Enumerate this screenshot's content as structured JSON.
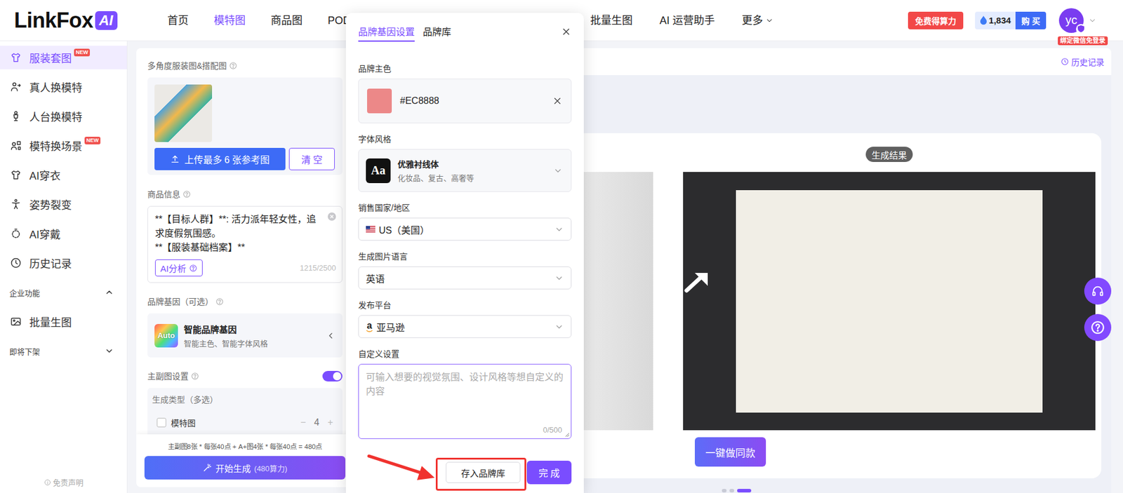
{
  "header": {
    "logo": {
      "text": "LinkFox",
      "badge": "AI"
    },
    "nav": [
      {
        "label": "首页",
        "selected": false,
        "dropdown": false
      },
      {
        "label": "模特图",
        "selected": true,
        "dropdown": false
      },
      {
        "label": "商品图",
        "selected": false,
        "dropdown": false
      },
      {
        "label": "POD",
        "selected": false,
        "dropdown": false
      },
      {
        "label": "批量生图",
        "selected": false,
        "dropdown": false
      },
      {
        "label": "AI 运营助手",
        "selected": false,
        "dropdown": false
      },
      {
        "label": "更多",
        "selected": false,
        "dropdown": true
      }
    ],
    "free_button": "免费得算力",
    "points": "1,834",
    "buy_button": "购 买",
    "avatar": "yc",
    "bind_tag": "绑定微信免登录"
  },
  "sidebar": {
    "items": [
      {
        "kind": "item",
        "label": "服装套图",
        "badge": "NEW",
        "selected": true
      },
      {
        "kind": "item",
        "label": "真人换模特",
        "selected": false
      },
      {
        "kind": "item",
        "label": "人台换模特",
        "selected": false
      },
      {
        "kind": "item",
        "label": "模特换场景",
        "badge": "NEW",
        "selected": false
      },
      {
        "kind": "item",
        "label": "AI穿衣",
        "selected": false
      },
      {
        "kind": "item",
        "label": "姿势裂变",
        "selected": false
      },
      {
        "kind": "item",
        "label": "AI穿戴",
        "selected": false
      },
      {
        "kind": "item",
        "label": "历史记录",
        "selected": false
      },
      {
        "kind": "section",
        "label": "企业功能",
        "expanded": true
      },
      {
        "kind": "item",
        "label": "批量生图",
        "selected": false
      },
      {
        "kind": "section",
        "label": "即将下架",
        "expanded": false
      }
    ],
    "footer": "免责声明"
  },
  "form": {
    "upload": {
      "label": "多角度服装图&搭配图",
      "upload_button": "上传最多 6 张参考图",
      "clear_button": "清 空"
    },
    "product_info": {
      "label": "商品信息",
      "lines": [
        "**【目标人群】**: 活力派年轻女性，追求度假氛围感。",
        "**【服装基础档案】**"
      ],
      "ai_button": "AI分析",
      "counter": "1215/2500"
    },
    "brand_gene": {
      "label": "品牌基因（可选）",
      "icon": "Auto",
      "title": "智能品牌基因",
      "subtitle": "智能主色、智能字体风格"
    },
    "main_sub": {
      "label": "主副图设置",
      "on": true
    },
    "gen_type": {
      "label": "生成类型（多选）",
      "options": [
        {
          "label": "模特图",
          "checked": false,
          "minus": "−",
          "count": "4",
          "plus": "+"
        }
      ]
    },
    "cost": "主副图8张 * 每张40点 + A+图4张 * 每张40点 = 480点",
    "start_button": {
      "label": "开始生成",
      "cost": "(480算力)"
    }
  },
  "modal": {
    "tabs": [
      {
        "label": "品牌基因设置",
        "selected": true
      },
      {
        "label": "品牌库",
        "selected": false
      }
    ],
    "fields": [
      {
        "kind": "color",
        "label": "品牌主色",
        "value": "#EC8888",
        "color": "#EC8888"
      },
      {
        "kind": "font",
        "label": "字体风格",
        "icon": "Aa",
        "title": "优雅衬线体",
        "subtitle": "化妆品、复古、高奢等"
      },
      {
        "kind": "country",
        "label": "销售国家/地区",
        "value": "US（美国）"
      },
      {
        "kind": "select",
        "label": "生成图片语言",
        "value": "英语"
      },
      {
        "kind": "platform",
        "label": "发布平台",
        "icon": "a",
        "value": "亚马逊"
      },
      {
        "kind": "textarea",
        "label": "自定义设置",
        "placeholder": "可输入想要的视觉氛围、设计风格等想自定义的内容",
        "counter": "0/500",
        "focused": true
      }
    ],
    "save_button": "存入品牌库",
    "done_button": "完 成"
  },
  "result": {
    "history_link": "历史记录",
    "label": "生成结果",
    "copy_button": "一键做同款",
    "pages": [
      {
        "selected": false
      },
      {
        "selected": false
      },
      {
        "selected": true
      }
    ]
  }
}
